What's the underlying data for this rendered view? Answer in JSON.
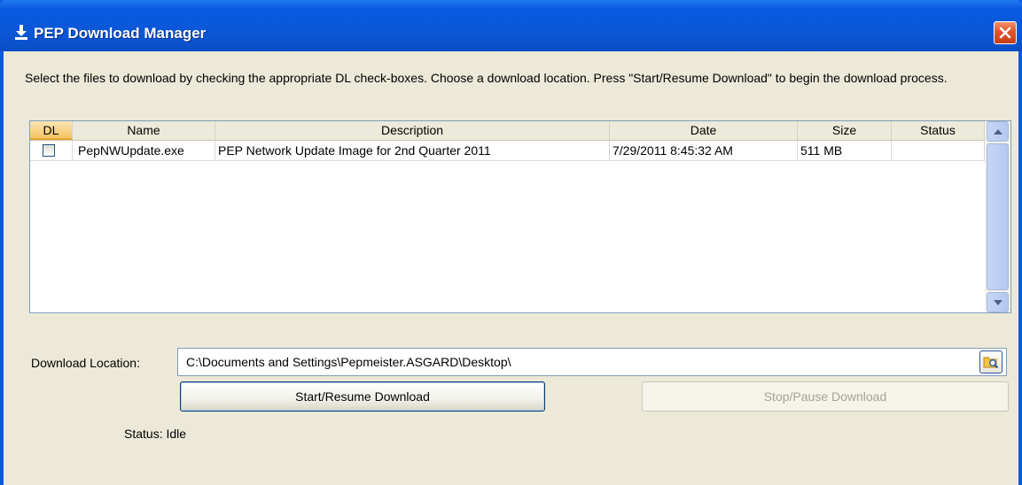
{
  "window": {
    "title": "PEP Download Manager",
    "accent_color": "#0a5ae0",
    "close_color": "#e0552b"
  },
  "instructions": "Select the files to download by checking the appropriate DL check-boxes. Choose a download location. Press \"Start/Resume Download\" to begin the download process.",
  "grid": {
    "columns": [
      "DL",
      "Name",
      "Description",
      "Date",
      "Size",
      "Status"
    ],
    "rows": [
      {
        "checked": false,
        "name": "PepNWUpdate.exe",
        "description": "PEP Network Update Image for 2nd Quarter 2011",
        "date": "7/29/2011 8:45:32 AM",
        "size": "511 MB",
        "status": ""
      }
    ]
  },
  "download_location": {
    "label": "Download Location:",
    "value": "C:\\Documents and Settings\\Pepmeister.ASGARD\\Desktop\\",
    "browse_icon": "folder-search-icon"
  },
  "buttons": {
    "start": "Start/Resume Download",
    "stop": "Stop/Pause Download"
  },
  "status": {
    "text": "Status: Idle"
  }
}
